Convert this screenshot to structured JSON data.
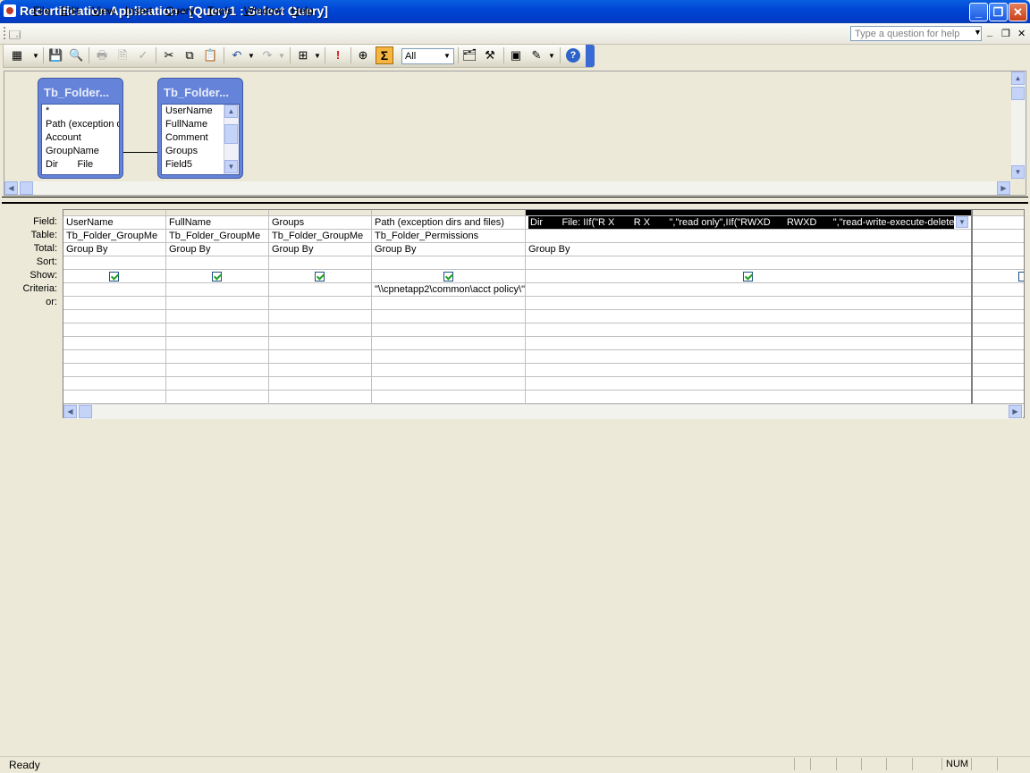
{
  "window": {
    "title": "Recertification Application - [Query1 : Select Query]",
    "controls": {
      "minimize": "_",
      "restore": "❐",
      "close": "✕"
    }
  },
  "menu": {
    "items": [
      {
        "label": "File",
        "key": "F",
        "rest": "ile"
      },
      {
        "label": "Edit",
        "key": "E",
        "rest": "dit"
      },
      {
        "label": "View",
        "key": "V",
        "rest": "iew"
      },
      {
        "label": "Insert",
        "key": "I",
        "rest": "nsert"
      },
      {
        "label": "Query",
        "key": "Q",
        "rest": "uery"
      },
      {
        "label": "Tools",
        "key": "T",
        "rest": "ools"
      },
      {
        "label": "Window",
        "key": "W",
        "rest": "indow"
      },
      {
        "label": "Help",
        "key": "H",
        "rest": "elp"
      }
    ],
    "help_placeholder": "Type a question for help",
    "mdi": {
      "minimize": "_",
      "restore": "❐",
      "close": "✕"
    }
  },
  "toolbar": {
    "top_values_combo": "All",
    "totals_label": "Σ"
  },
  "tables": [
    {
      "title": "Tb_Folder...",
      "fields": [
        "*",
        "Path (exception d",
        "Account",
        "GroupName",
        "Dir       File"
      ]
    },
    {
      "title": "Tb_Folder...",
      "fields": [
        "UserName",
        "FullName",
        "Comment",
        "Groups",
        "Field5"
      ]
    }
  ],
  "grid": {
    "row_labels": [
      "Field:",
      "Table:",
      "Total:",
      "Sort:",
      "Show:",
      "Criteria:",
      "or:"
    ],
    "columns": [
      {
        "field": "UserName",
        "table": "Tb_Folder_GroupMe",
        "total": "Group By",
        "sort": "",
        "show": true,
        "criteria": "",
        "or": ""
      },
      {
        "field": "FullName",
        "table": "Tb_Folder_GroupMe",
        "total": "Group By",
        "sort": "",
        "show": true,
        "criteria": "",
        "or": ""
      },
      {
        "field": "Groups",
        "table": "Tb_Folder_GroupMe",
        "total": "Group By",
        "sort": "",
        "show": true,
        "criteria": "",
        "or": ""
      },
      {
        "field": "Path (exception dirs and files)",
        "table": "Tb_Folder_Permissions",
        "total": "Group By",
        "sort": "",
        "show": true,
        "criteria": "\"\\\\cpnetapp2\\common\\acct policy\\\"",
        "or": ""
      },
      {
        "field": "Dir       File: IIf(\"R X       R X       \",\"read only\",IIf(\"RWXD      RWXD      \",\"read-write-execute-delete",
        "table": "",
        "total": "Group By",
        "sort": "",
        "show": true,
        "criteria": "",
        "or": ""
      }
    ]
  },
  "status": {
    "text": "Ready",
    "num_indicator": "NUM"
  }
}
